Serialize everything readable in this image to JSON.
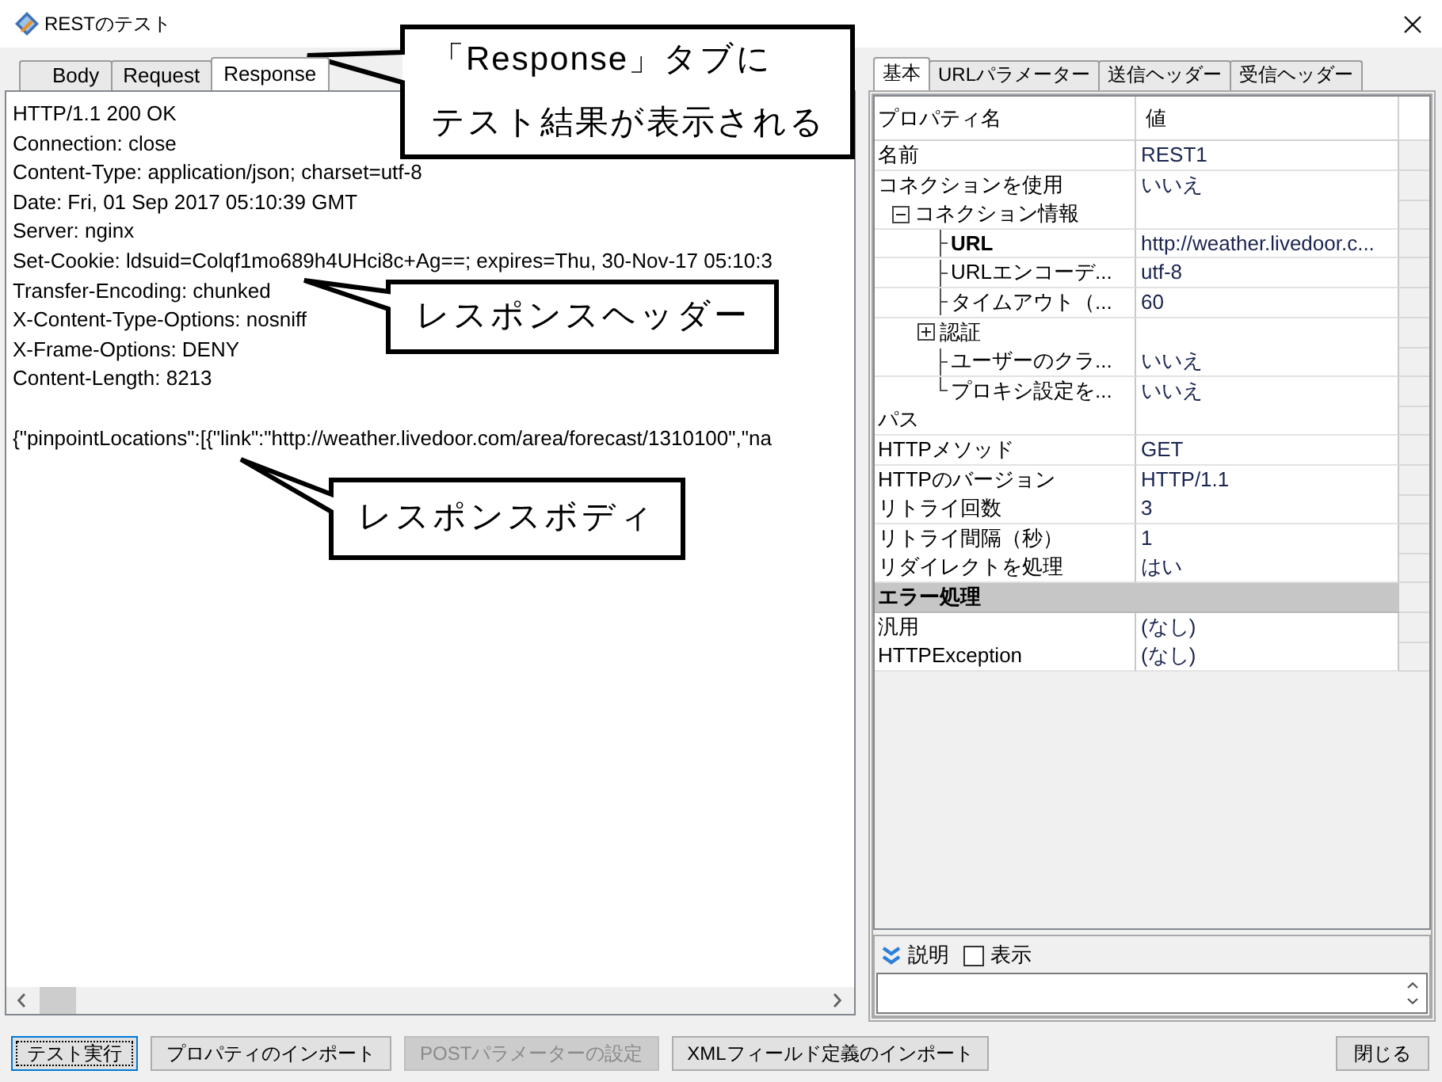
{
  "window": {
    "title": "RESTのテスト"
  },
  "response_panel": {
    "tabs": [
      {
        "label": "Body",
        "selected": false
      },
      {
        "label": "Request",
        "selected": false
      },
      {
        "label": "Response",
        "selected": true
      }
    ],
    "header_lines": [
      "HTTP/1.1 200 OK",
      "Connection: close",
      "Content-Type: application/json; charset=utf-8",
      "Date: Fri, 01 Sep 2017 05:10:39 GMT",
      "Server: nginx",
      "Set-Cookie: ldsuid=Colqf1mo689h4UHci8c+Ag==; expires=Thu, 30-Nov-17 05:10:3",
      "Transfer-Encoding: chunked",
      "X-Content-Type-Options: nosniff",
      "X-Frame-Options: DENY",
      "Content-Length: 8213"
    ],
    "body_line": "{\"pinpointLocations\":[{\"link\":\"http://weather.livedoor.com/area/forecast/1310100\",\"na"
  },
  "settings_panel": {
    "tabs": [
      {
        "label": "基本",
        "selected": true
      },
      {
        "label": "URLパラメーター",
        "selected": false
      },
      {
        "label": "送信ヘッダー",
        "selected": false
      },
      {
        "label": "受信ヘッダー",
        "selected": false
      }
    ],
    "property_grid": {
      "columns": [
        "プロパティ名",
        "値"
      ],
      "rows": [
        {
          "kind": "property",
          "name": "名前",
          "value": "REST1",
          "emphasized": false
        },
        {
          "kind": "property",
          "name": "コネクションを使用",
          "value": "いいえ",
          "emphasized": false
        },
        {
          "kind": "group",
          "name": "コネクション情報",
          "expanded": true,
          "children": [
            {
              "kind": "property",
              "name": "URL",
              "value": "http://weather.livedoor.c...",
              "emphasized": true
            },
            {
              "kind": "property",
              "name": "URLエンコーデ...",
              "value": "utf-8",
              "emphasized": false
            },
            {
              "kind": "property",
              "name": "タイムアウト（...",
              "value": "60",
              "emphasized": false
            },
            {
              "kind": "group",
              "name": "認証",
              "expanded": false
            },
            {
              "kind": "property",
              "name": "ユーザーのクラ...",
              "value": "いいえ",
              "emphasized": false
            },
            {
              "kind": "property",
              "name": "プロキシ設定を...",
              "value": "いいえ",
              "emphasized": false
            }
          ]
        },
        {
          "kind": "property",
          "name": "パス",
          "emphasized": false
        },
        {
          "kind": "property",
          "name": "HTTPメソッド",
          "value": "GET",
          "emphasized": false
        },
        {
          "kind": "property",
          "name": "HTTPのバージョン",
          "value": "HTTP/1.1",
          "emphasized": false
        },
        {
          "kind": "property",
          "name": "リトライ回数",
          "value": "3",
          "emphasized": false
        },
        {
          "kind": "property",
          "name": "リトライ間隔（秒）",
          "value": "1",
          "emphasized": false
        },
        {
          "kind": "property",
          "name": "リダイレクトを処理",
          "value": "はい",
          "emphasized": false
        },
        {
          "kind": "category",
          "name": "エラー処理",
          "children": [
            {
              "kind": "property",
              "name": "汎用",
              "value": "(なし)",
              "emphasized": false
            },
            {
              "kind": "property",
              "name": "HTTPException",
              "value": "(なし)",
              "emphasized": false
            }
          ]
        }
      ]
    },
    "description": {
      "label": "説明",
      "checkbox": {
        "label": "表示",
        "checked": false
      }
    }
  },
  "footer": {
    "buttons": [
      {
        "label": "テスト実行",
        "disabled": false,
        "focused": true
      },
      {
        "label": "プロパティのインポート",
        "disabled": false,
        "focused": false
      },
      {
        "label": "POSTパラメーターの設定",
        "disabled": true,
        "focused": false
      },
      {
        "label": "XMLフィールド定義のインポート",
        "disabled": false,
        "focused": false
      }
    ],
    "close_button": {
      "label": "閉じる"
    }
  },
  "callouts": [
    {
      "lines": [
        "「Response」タブに",
        "テスト結果が表示される"
      ]
    },
    {
      "lines": [
        "レスポンスヘッダー"
      ]
    },
    {
      "lines": [
        "レスポンスボディ"
      ]
    }
  ]
}
